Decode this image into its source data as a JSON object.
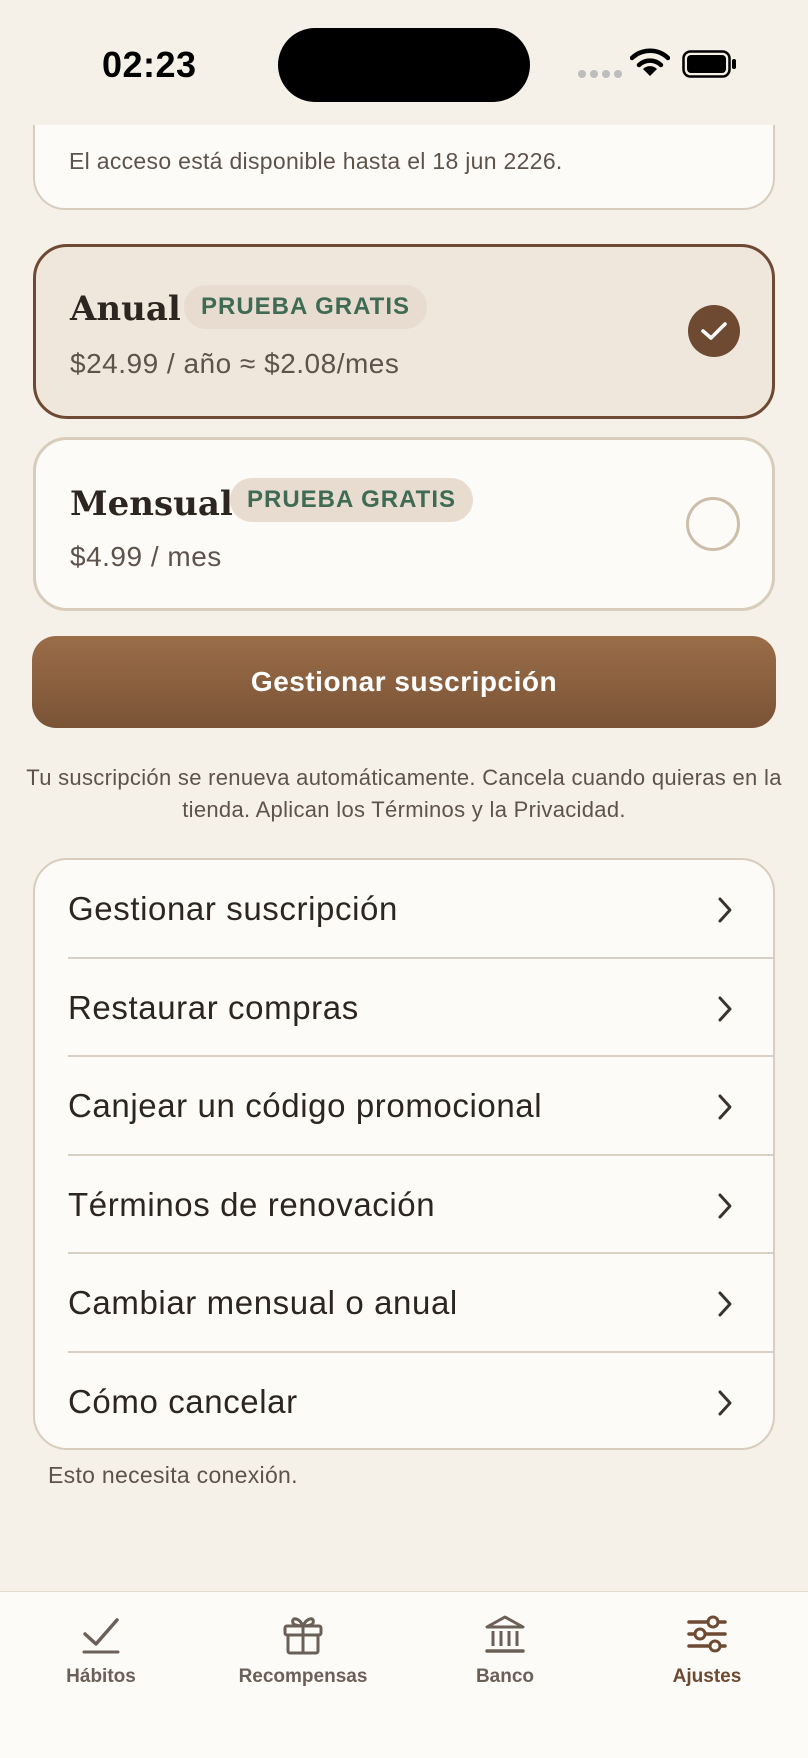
{
  "status_bar": {
    "time": "02:23"
  },
  "top_card": {
    "text": "El acceso está disponible hasta el 18 jun 2226."
  },
  "plans": [
    {
      "title": "Anual",
      "badge": "PRUEBA GRATIS",
      "price": "$24.99 / año ≈ $2.08/mes",
      "selected": true
    },
    {
      "title": "Mensual",
      "badge": "PRUEBA GRATIS",
      "price": "$4.99 / mes",
      "selected": false
    }
  ],
  "primary_button": "Gestionar suscripción",
  "disclaimer": "Tu suscripción se renueva automáticamente. Cancela cuando quieras en la tienda. Aplican los Términos y la Privacidad.",
  "menu": {
    "items": [
      {
        "label": "Gestionar suscripción"
      },
      {
        "label": "Restaurar compras"
      },
      {
        "label": "Canjear un código promocional"
      },
      {
        "label": "Términos de renovación"
      },
      {
        "label": "Cambiar mensual o anual"
      },
      {
        "label": "Cómo cancelar"
      }
    ]
  },
  "footnote": "Esto necesita conexión.",
  "tab_bar": {
    "tabs": [
      {
        "label": "Hábitos",
        "icon": "checkmark-icon"
      },
      {
        "label": "Recompensas",
        "icon": "gift-icon"
      },
      {
        "label": "Banco",
        "icon": "bank-icon"
      },
      {
        "label": "Ajustes",
        "icon": "sliders-icon",
        "active": true
      }
    ]
  },
  "colors": {
    "accent": "#6e4a33",
    "badge_text": "#3f6b54",
    "background": "#f5f0e8"
  }
}
